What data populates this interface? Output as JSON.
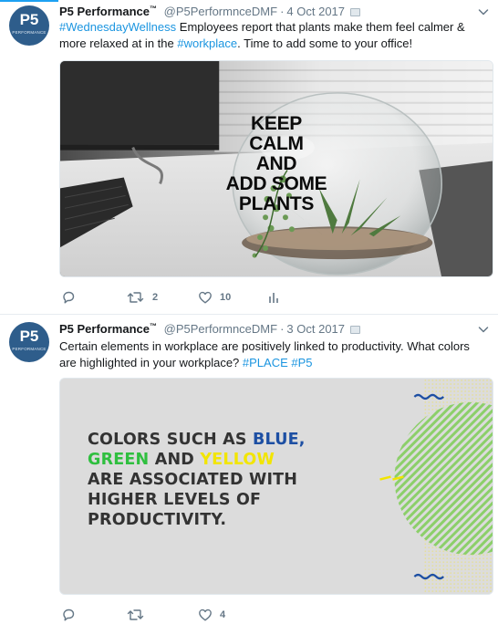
{
  "tweets": [
    {
      "author_name": "P5 Performance",
      "author_mark": "™",
      "handle": "@P5PerformnceDMF",
      "separator": "·",
      "date": "4 Oct 2017",
      "avatar": {
        "logo_text": "P5",
        "logo_subtext": "PERFORMANCE"
      },
      "text_parts": {
        "hashtag1": "#WednesdayWellness",
        "body1": " Employees report that plants make them feel calmer & more relaxed at in the ",
        "hashtag2": "#workplace",
        "body2": ". Time to add some to your office!"
      },
      "media": {
        "overlay_lines": [
          "KEEP",
          "CALM",
          "AND",
          "ADD SOME",
          "PLANTS"
        ]
      },
      "actions": {
        "reply": "",
        "retweet": "2",
        "like": "10"
      }
    },
    {
      "author_name": "P5 Performance",
      "author_mark": "™",
      "handle": "@P5PerformnceDMF",
      "separator": "·",
      "date": "3 Oct 2017",
      "avatar": {
        "logo_text": "P5",
        "logo_subtext": "PERFORMANCE"
      },
      "text_parts": {
        "body1": "Certain elements in workplace are positively linked to productivity. What colors are highlighted in your workplace? ",
        "hashtag1": "#PLACE",
        "space": " ",
        "hashtag2": "#P5"
      },
      "media": {
        "line1_a": "COLORS SUCH AS ",
        "line1_b": "BLUE,",
        "line2_a": "GREEN",
        "line2_b": " AND ",
        "line2_c": "YELLOW",
        "line3": "ARE ASSOCIATED WITH",
        "line4": "HIGHER LEVELS OF",
        "line5": "PRODUCTIVITY."
      },
      "actions": {
        "reply": "",
        "retweet": "",
        "like": "4"
      }
    }
  ],
  "colors": {
    "link": "#1b95e0",
    "secondary_text": "#657786",
    "avatar_bg": "#2e5d8b",
    "accent_blue": "#1d4fa3",
    "accent_green": "#2fbf3f",
    "accent_yellow": "#f2e500"
  }
}
